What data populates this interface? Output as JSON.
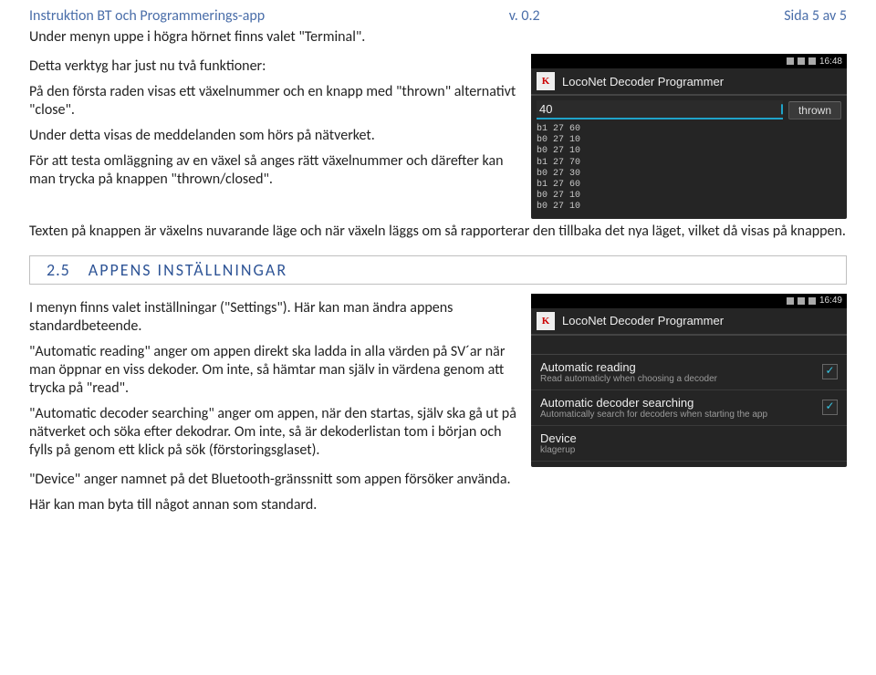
{
  "header": {
    "left": "Instruktion BT och Programmerings-app",
    "center": "v. 0.2",
    "right": "Sida 5 av 5"
  },
  "intro": "Under menyn uppe i högra hörnet finns valet \"Terminal\".",
  "block1": {
    "p1": "Detta verktyg har just nu två funktioner:",
    "p2": "På den första raden visas ett växelnummer och en knapp med \"thrown\" alternativt \"close\".",
    "p3": "Under detta visas de meddelanden som hörs på nätverket.",
    "p4": "För att testa omläggning av en växel så anges rätt växelnummer och därefter kan man trycka på knappen \"thrown/closed\"."
  },
  "p5": "Texten på knappen är växelns nuvarande läge och när växeln läggs om så rapporterar den tillbaka det nya läget, vilket då visas på knappen.",
  "section": {
    "num": "2.5",
    "title": "APPENS INSTÄLLNINGAR"
  },
  "block2": {
    "p1": "I menyn finns valet inställningar (\"Settings\"). Här kan man ändra appens standardbeteende.",
    "p2": "\"Automatic reading\" anger om appen direkt ska ladda in alla värden på SV´ar när man öppnar en viss dekoder. Om inte, så hämtar man själv in värdena genom att trycka på \"read\".",
    "p3": "\"Automatic decoder searching\" anger om appen, när den startas, själv ska gå ut på nätverket och söka efter dekodrar. Om inte, så är dekoderlistan tom i början och fylls på genom ett klick på sök (förstoringsglaset)."
  },
  "p6": "\"Device\" anger namnet på det Bluetooth-gränssnitt som appen försöker använda.",
  "p7": "Här kan man byta till något annan som standard.",
  "phone1": {
    "time": "16:48",
    "title": "LocoNet Decoder Programmer",
    "input": "40",
    "button": "thrown",
    "log": [
      "b1 27 60",
      "b0 27 10",
      "b0 27 10",
      "b1 27 70",
      "b0 27 30",
      "b1 27 60",
      "b0 27 10",
      "b0 27 10"
    ]
  },
  "phone2": {
    "time": "16:49",
    "title": "LocoNet Decoder Programmer",
    "items": [
      {
        "label": "Automatic reading",
        "desc": "Read automaticly when choosing a decoder",
        "checked": true
      },
      {
        "label": "Automatic decoder searching",
        "desc": "Automatically search for decoders when starting the app",
        "checked": true
      }
    ],
    "device_label": "Device",
    "device_value": "klagerup"
  }
}
